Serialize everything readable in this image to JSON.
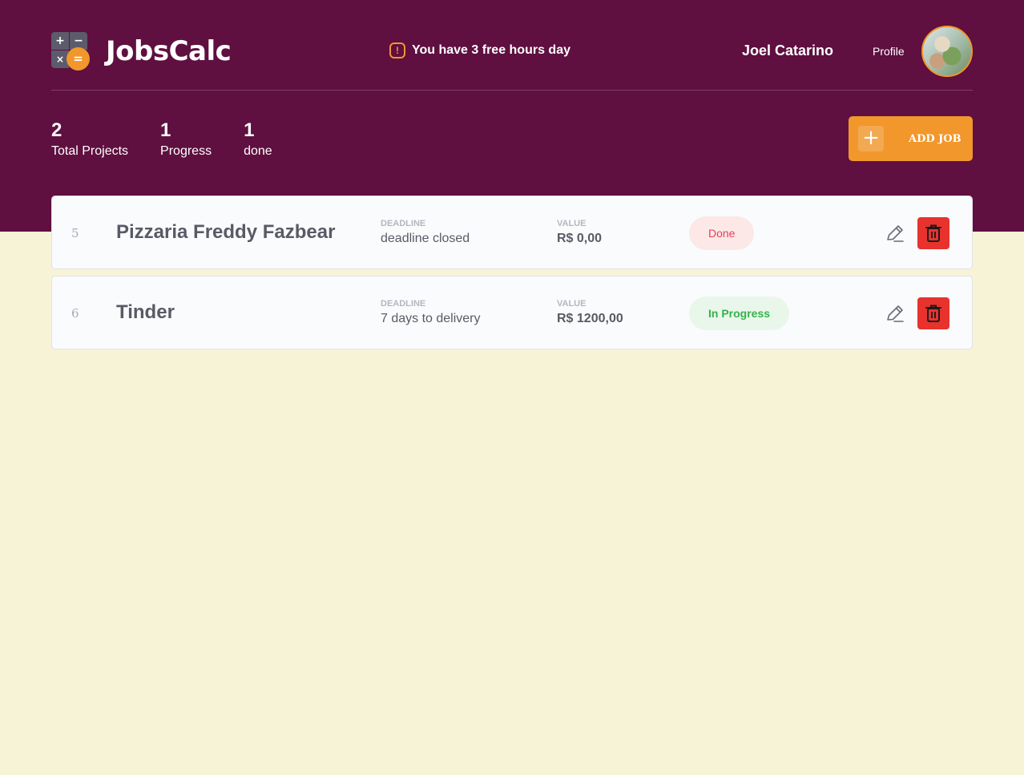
{
  "app": {
    "title": "JobsCalc",
    "logo_symbols": [
      "+",
      "−",
      "×",
      "="
    ]
  },
  "header": {
    "alert_text": "You have 3 free hours day",
    "alert_icon": "alert-octagon-icon",
    "user_name": "Joel Catarino",
    "profile_label": "Profile"
  },
  "summary": {
    "total": {
      "value": "2",
      "label": "Total Projects"
    },
    "progress": {
      "value": "1",
      "label": "Progress"
    },
    "done": {
      "value": "1",
      "label": "done"
    }
  },
  "add_job": {
    "label": "ADD JOB",
    "icon": "+"
  },
  "jobs": [
    {
      "id": "5",
      "name": "Pizzaria Freddy Fazbear",
      "deadline_label": "DEADLINE",
      "deadline_value": "deadline closed",
      "value_label": "VALUE",
      "value_value": "R$ 0,00",
      "status": "Done"
    },
    {
      "id": "6",
      "name": "Tinder",
      "deadline_label": "DEADLINE",
      "deadline_value": "7 days to delivery",
      "value_label": "VALUE",
      "value_value": "R$ 1200,00",
      "status": "In Progress"
    }
  ],
  "colors": {
    "header_bg": "#5F0F40",
    "page_bg": "#F7F3D6",
    "accent": "#F1972C",
    "danger": "#E8322E",
    "done_text": "#E83F5B",
    "progress_text": "#36B24A"
  }
}
